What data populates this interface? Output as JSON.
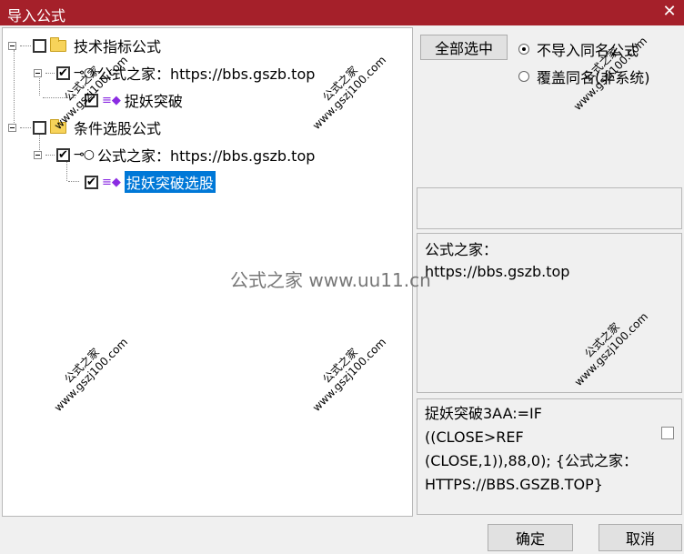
{
  "window": {
    "title": "导入公式",
    "close_symbol": "✕"
  },
  "tree": {
    "nodes": [
      {
        "label": "技术指标公式",
        "checked": false
      },
      {
        "label": "公式之家：https://bbs.gszb.top",
        "checked": true
      },
      {
        "label": "捉妖突破",
        "checked": true
      },
      {
        "label": "条件选股公式",
        "checked": false
      },
      {
        "label": "公式之家：https://bbs.gszb.top",
        "checked": true
      },
      {
        "label": "捉妖突破选股",
        "checked": true,
        "selected": true
      }
    ],
    "check_mark": "✔"
  },
  "controls": {
    "select_all": "全部选中",
    "option_skip": "不导入同名公式",
    "option_overwrite": "覆盖同名(非系统)",
    "selected_option": "option_skip"
  },
  "info": {
    "source_label": "公式之家：",
    "source_url": "https://bbs.gszb.top",
    "formula_lines": [
      "捉妖突破3AA:=IF",
      "((CLOSE>REF",
      "(CLOSE,1)),88,0); {公式之家：",
      "HTTPS://BBS.GSZB.TOP}"
    ]
  },
  "footer": {
    "ok": "确定",
    "cancel": "取消"
  },
  "watermarks": {
    "brand": "公式之家",
    "site": "www.gszj100.com",
    "center": "公式之家 www.uu11.cn"
  }
}
